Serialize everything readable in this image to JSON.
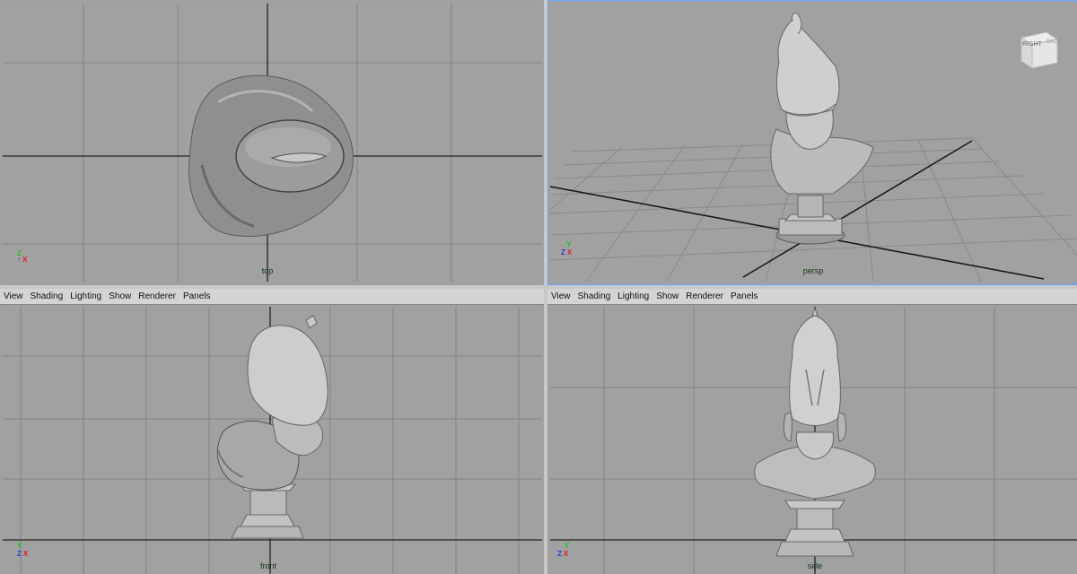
{
  "menus": [
    "View",
    "Shading",
    "Lighting",
    "Show",
    "Renderer",
    "Panels"
  ],
  "viewports": {
    "top": {
      "label": "top"
    },
    "persp": {
      "label": "persp",
      "viewcube": [
        "RIGHT",
        "BACK"
      ]
    },
    "front": {
      "label": "front"
    },
    "side": {
      "label": "side"
    }
  },
  "axes": {
    "x": "X",
    "y": "Y",
    "z": "Z"
  },
  "colors": {
    "grid": "#7f7f7f",
    "axis_line": "#222222",
    "bg": "#a1a1a1",
    "x": "#e02020",
    "y": "#20c020",
    "z": "#2040e0"
  }
}
